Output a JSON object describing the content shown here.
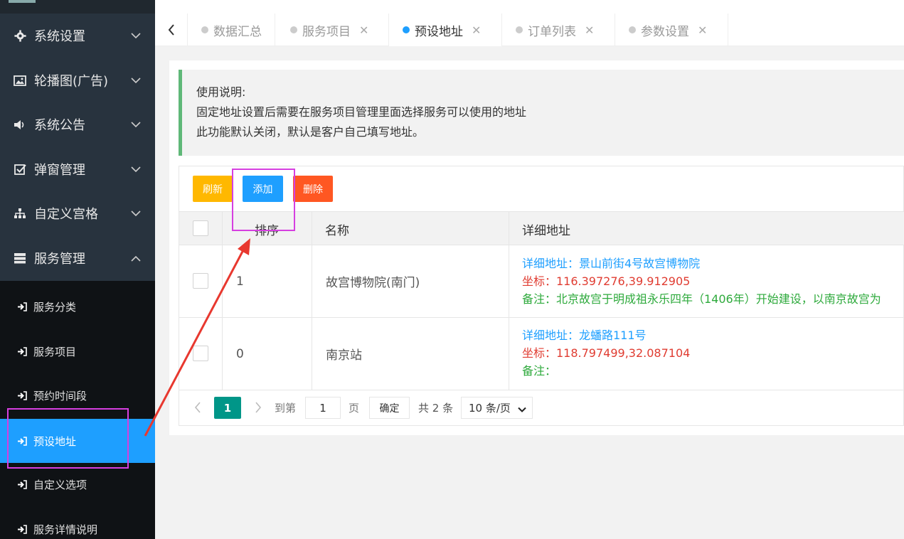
{
  "sidebar": {
    "menus": [
      {
        "label": "系统设置",
        "icon": "gear-icon"
      },
      {
        "label": "轮播图(广告)",
        "icon": "image-icon"
      },
      {
        "label": "系统公告",
        "icon": "speaker-icon"
      },
      {
        "label": "弹窗管理",
        "icon": "checkbox-icon"
      },
      {
        "label": "自定义宫格",
        "icon": "sitemap-icon"
      },
      {
        "label": "服务管理",
        "icon": "server-icon"
      }
    ],
    "sub_items": [
      {
        "label": "服务分类"
      },
      {
        "label": "服务项目"
      },
      {
        "label": "预约时间段"
      },
      {
        "label": "预设地址"
      },
      {
        "label": "自定义选项"
      },
      {
        "label": "服务详情说明"
      }
    ]
  },
  "tabs": [
    {
      "label": "数据汇总"
    },
    {
      "label": "服务项目"
    },
    {
      "label": "预设地址"
    },
    {
      "label": "订单列表"
    },
    {
      "label": "参数设置"
    }
  ],
  "notice": {
    "line1": "使用说明:",
    "line2": "固定地址设置后需要在服务项目管理里面选择服务可以使用的地址",
    "line3": "此功能默认关闭，默认是客户自己填写地址。"
  },
  "toolbar": {
    "refresh_label": "刷新",
    "add_label": "添加",
    "delete_label": "删除"
  },
  "table": {
    "headers": {
      "sort": "排序",
      "name": "名称",
      "detail": "详细地址"
    },
    "rows": [
      {
        "sort": "1",
        "name": "故宫博物院(南门)",
        "address": "详细地址：景山前街4号故宫博物院",
        "coords": "坐标：116.397276,39.912905",
        "note": "备注：北京故宫于明成祖永乐四年（1406年）开始建设，以南京故宫为"
      },
      {
        "sort": "0",
        "name": "南京站",
        "address": "详细地址：龙蟠路111号",
        "coords": "坐标：118.797499,32.087104",
        "note": "备注："
      }
    ]
  },
  "pager": {
    "current": "1",
    "goto_label": "到第",
    "goto_value": "1",
    "page_unit": "页",
    "confirm_label": "确定",
    "total_label": "共 2 条",
    "page_size": "10 条/页"
  },
  "colors": {
    "active": "#1e9fff",
    "refresh": "#ffb800",
    "delete": "#ff5722",
    "pager_current": "#009688",
    "annotation": "#d63fe0",
    "arrow": "#e8382f"
  }
}
